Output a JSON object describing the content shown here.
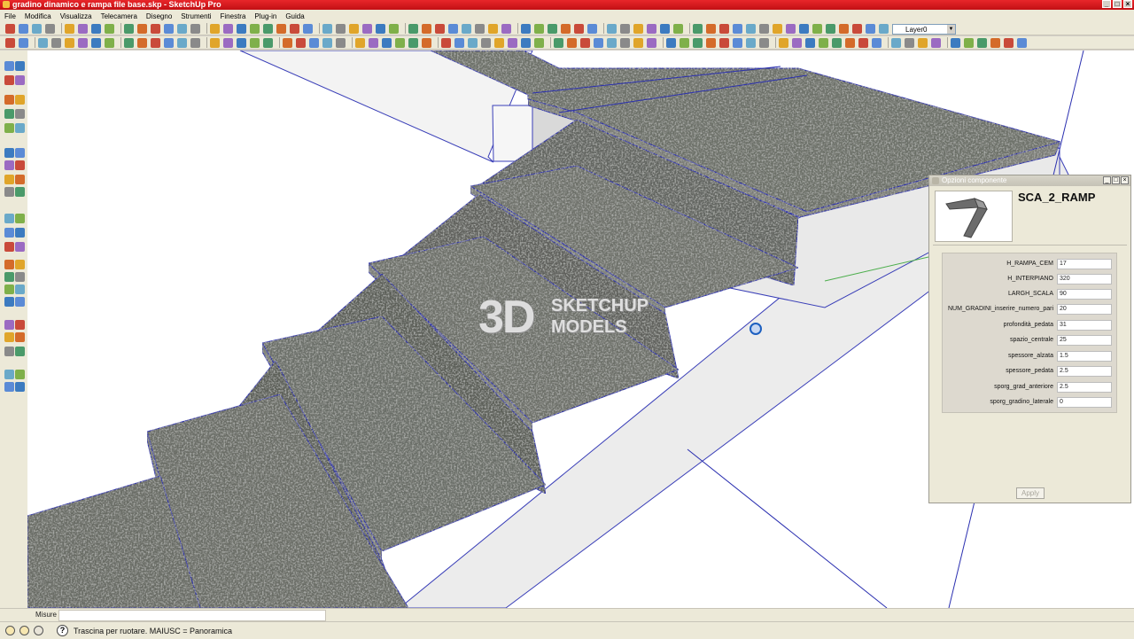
{
  "window": {
    "title": "gradino dinamico e rampa file base.skp - SketchUp Pro"
  },
  "menu": [
    "File",
    "Modifica",
    "Visualizza",
    "Telecamera",
    "Disegno",
    "Strumenti",
    "Finestra",
    "Plug-in",
    "Guida"
  ],
  "layer": {
    "current": "Layer0"
  },
  "watermark": {
    "big": "3D",
    "line1": "SKETCHUP",
    "line2": "MODELS"
  },
  "component_options": {
    "title": "Opzioni componente",
    "name": "SCA_2_RAMP",
    "fields": [
      {
        "label": "H_RAMPA_CEM",
        "value": "17"
      },
      {
        "label": "H_INTERPIANO",
        "value": "320"
      },
      {
        "label": "LARGH_SCALA",
        "value": "90"
      },
      {
        "label": "NUM_GRADINI_inserire_numero_pari",
        "value": "20"
      },
      {
        "label": "profondità_pedata",
        "value": "31"
      },
      {
        "label": "spazio_centrale",
        "value": "25"
      },
      {
        "label": "spessore_alzata",
        "value": "1.5"
      },
      {
        "label": "spessore_pedata",
        "value": "2.5"
      },
      {
        "label": "sporg_grad_anteriore",
        "value": "2.5"
      },
      {
        "label": "sporg_gradino_laterale",
        "value": "0"
      }
    ],
    "apply_label": "Apply"
  },
  "measurements": {
    "label": "Misure",
    "value": ""
  },
  "status": {
    "text": "Trascina per ruotare.  MAIUSC = Panoramica"
  },
  "colors": {
    "title_bar": "#d0181c",
    "stone": "#6b6e66",
    "edge": "#2a2fb0"
  }
}
